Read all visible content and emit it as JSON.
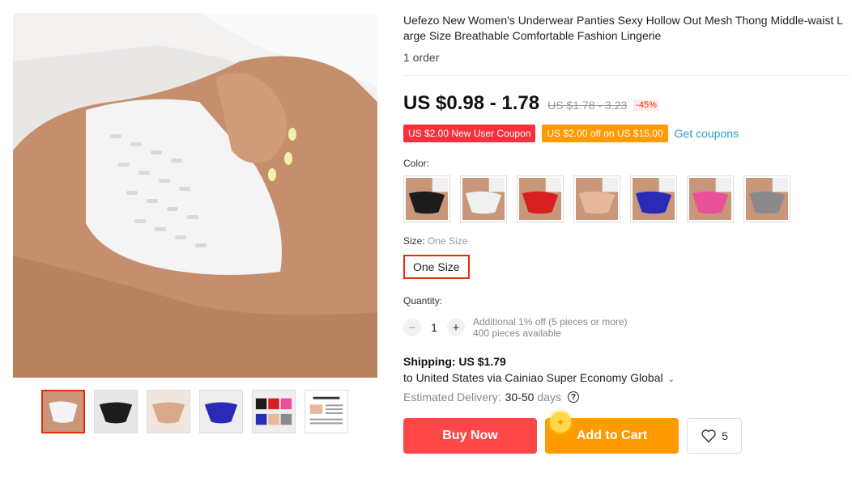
{
  "product": {
    "title": "Uefezo New Women's Underwear Panties Sexy Hollow Out Mesh Thong Middle-waist Large Size Breathable Comfortable Fashion Lingerie",
    "orders": "1 order"
  },
  "price": {
    "current": "US $0.98 - 1.78",
    "original": "US $1.78 - 3.23",
    "discount": "-45%"
  },
  "coupons": {
    "new_user": "US $2.00 New User Coupon",
    "store": "US $2.00 off on US $15.00",
    "get_link": "Get coupons"
  },
  "color": {
    "label": "Color:",
    "swatches": [
      {
        "name": "black",
        "color": "#1c1c1c"
      },
      {
        "name": "white",
        "color": "#f0f0f0"
      },
      {
        "name": "red",
        "color": "#d81e1e"
      },
      {
        "name": "skin",
        "color": "#e7b79a"
      },
      {
        "name": "blue",
        "color": "#2a2ab8"
      },
      {
        "name": "pink",
        "color": "#e8509a"
      },
      {
        "name": "gray",
        "color": "#8a8a8a"
      }
    ]
  },
  "size": {
    "label": "Size:",
    "selected": "One Size",
    "option": "One Size"
  },
  "quantity": {
    "label": "Quantity:",
    "minus": "−",
    "value": "1",
    "plus": "+",
    "additional": "Additional 1% off (5 pieces or more)",
    "available": "400 pieces available"
  },
  "shipping": {
    "title": "Shipping: US $1.79",
    "to": "to United States via Cainiao Super Economy Global",
    "chevron": "⌄",
    "delivery_label": "Estimated Delivery:",
    "delivery_days": "30-50",
    "delivery_unit": "days",
    "help": "?"
  },
  "actions": {
    "buy_now": "Buy Now",
    "add_to_cart": "Add to Cart",
    "wishlist_count": "5"
  },
  "gallery": {
    "thumbs": [
      "white",
      "black",
      "skin",
      "blue",
      "multi",
      "size-chart"
    ]
  },
  "colors": {
    "accent_red": "#ff4747",
    "accent_orange": "#ff9a00",
    "link_blue": "#2e9cc3"
  }
}
